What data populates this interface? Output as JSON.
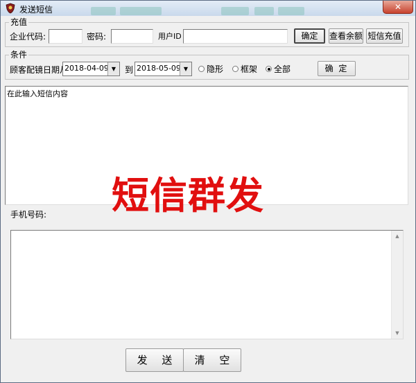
{
  "window": {
    "title": "发送短信",
    "close_glyph": "✕"
  },
  "recharge": {
    "group_label": "充值",
    "company_code_label": "企业代码:",
    "password_label": "密码:",
    "user_id_label": "用户ID",
    "company_code_value": "",
    "password_value": "",
    "user_id_value": "",
    "confirm_button": "确定",
    "balance_button": "查看余额",
    "recharge_button": "短信充值"
  },
  "conditions": {
    "group_label": "条件",
    "date_from_label": "顾客配镜日期从",
    "date_from": "2018-04-09",
    "to_label": "到",
    "date_to": "2018-05-09",
    "options": [
      {
        "label": "隐形",
        "selected": false
      },
      {
        "label": "框架",
        "selected": false
      },
      {
        "label": "全部",
        "selected": true
      }
    ],
    "confirm_button": "确 定"
  },
  "message": {
    "placeholder": "在此输入短信内容",
    "banner": "短信群发"
  },
  "phone": {
    "label": "手机号码:",
    "value": ""
  },
  "actions": {
    "send_button": "发 送",
    "clear_button": "清 空"
  },
  "icons": {
    "app": "shield-icon",
    "dropdown": "chevron-down-icon",
    "scroll_up": "arrow-up-icon",
    "scroll_down": "arrow-down-icon"
  },
  "colors": {
    "banner": "#e10f0f",
    "titlebar": "#c9d9ec",
    "close": "#c7422e"
  }
}
